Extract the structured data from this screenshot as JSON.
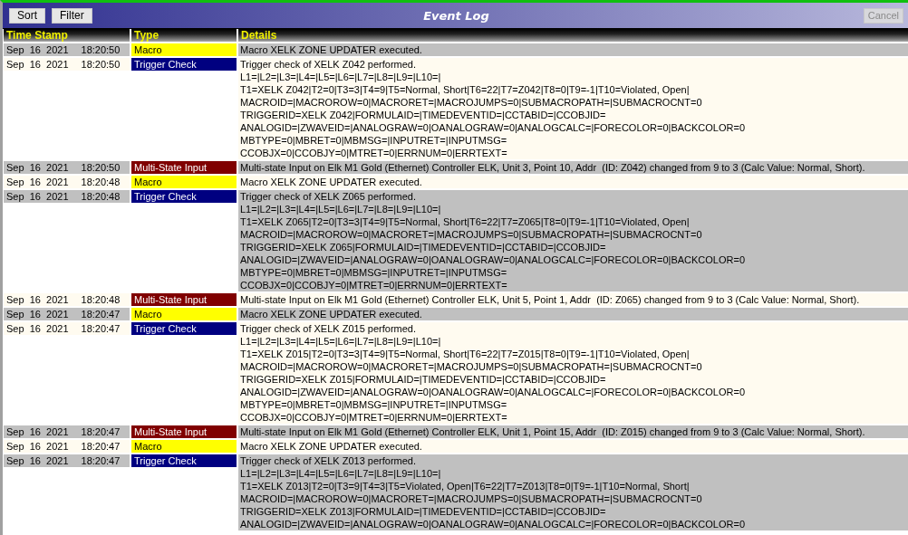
{
  "window": {
    "title": "Event Log"
  },
  "toolbar": {
    "buttons": [
      {
        "label": "Sort",
        "disabled": false
      },
      {
        "label": "Filter",
        "disabled": false
      }
    ],
    "cancel": {
      "label": "Cancel",
      "disabled": true
    }
  },
  "table": {
    "columns": [
      "Time Stamp",
      "Type",
      "Details"
    ],
    "rows": [
      {
        "date": "Sep  16  2021",
        "time": "18:20:50",
        "type": {
          "label": "Macro",
          "kind": "macro"
        },
        "details": [
          "Macro XELK ZONE UPDATER executed."
        ]
      },
      {
        "date": "Sep  16  2021",
        "time": "18:20:50",
        "type": {
          "label": "Trigger Check",
          "kind": "trigger"
        },
        "details": [
          "Trigger check of XELK Z042 performed.",
          "L1=|L2=|L3=|L4=|L5=|L6=|L7=|L8=|L9=|L10=|",
          "T1=XELK Z042|T2=0|T3=3|T4=9|T5=Normal, Short|T6=22|T7=Z042|T8=0|T9=-1|T10=Violated, Open|",
          "MACROID=|MACROROW=0|MACRORET=|MACROJUMPS=0|SUBMACROPATH=|SUBMACROCNT=0",
          "TRIGGERID=XELK Z042|FORMULAID=|TIMEDEVENTID=|CCTABID=|CCOBJID=",
          "ANALOGID=|ZWAVEID=|ANALOGRAW=0|OANALOGRAW=0|ANALOGCALC=|FORECOLOR=0|BACKCOLOR=0",
          "MBTYPE=0|MBRET=0|MBMSG=|INPUTRET=|INPUTMSG=",
          "CCOBJX=0|CCOBJY=0|MTRET=0|ERRNUM=0|ERRTEXT="
        ]
      },
      {
        "date": "Sep  16  2021",
        "time": "18:20:50",
        "type": {
          "label": "Multi-State Input",
          "kind": "multistate"
        },
        "details": [
          "Multi-state Input on Elk M1 Gold (Ethernet) Controller ELK, Unit 3, Point 10, Addr  (ID: Z042) changed from 9 to 3 (Calc Value: Normal, Short)."
        ]
      },
      {
        "date": "Sep  16  2021",
        "time": "18:20:48",
        "type": {
          "label": "Macro",
          "kind": "macro"
        },
        "details": [
          "Macro XELK ZONE UPDATER executed."
        ]
      },
      {
        "date": "Sep  16  2021",
        "time": "18:20:48",
        "type": {
          "label": "Trigger Check",
          "kind": "trigger"
        },
        "details": [
          "Trigger check of XELK Z065 performed.",
          "L1=|L2=|L3=|L4=|L5=|L6=|L7=|L8=|L9=|L10=|",
          "T1=XELK Z065|T2=0|T3=3|T4=9|T5=Normal, Short|T6=22|T7=Z065|T8=0|T9=-1|T10=Violated, Open|",
          "MACROID=|MACROROW=0|MACRORET=|MACROJUMPS=0|SUBMACROPATH=|SUBMACROCNT=0",
          "TRIGGERID=XELK Z065|FORMULAID=|TIMEDEVENTID=|CCTABID=|CCOBJID=",
          "ANALOGID=|ZWAVEID=|ANALOGRAW=0|OANALOGRAW=0|ANALOGCALC=|FORECOLOR=0|BACKCOLOR=0",
          "MBTYPE=0|MBRET=0|MBMSG=|INPUTRET=|INPUTMSG=",
          "CCOBJX=0|CCOBJY=0|MTRET=0|ERRNUM=0|ERRTEXT="
        ]
      },
      {
        "date": "Sep  16  2021",
        "time": "18:20:48",
        "type": {
          "label": "Multi-State Input",
          "kind": "multistate"
        },
        "details": [
          "Multi-state Input on Elk M1 Gold (Ethernet) Controller ELK, Unit 5, Point 1, Addr  (ID: Z065) changed from 9 to 3 (Calc Value: Normal, Short)."
        ]
      },
      {
        "date": "Sep  16  2021",
        "time": "18:20:47",
        "type": {
          "label": "Macro",
          "kind": "macro"
        },
        "details": [
          "Macro XELK ZONE UPDATER executed."
        ]
      },
      {
        "date": "Sep  16  2021",
        "time": "18:20:47",
        "type": {
          "label": "Trigger Check",
          "kind": "trigger"
        },
        "details": [
          "Trigger check of XELK Z015 performed.",
          "L1=|L2=|L3=|L4=|L5=|L6=|L7=|L8=|L9=|L10=|",
          "T1=XELK Z015|T2=0|T3=3|T4=9|T5=Normal, Short|T6=22|T7=Z015|T8=0|T9=-1|T10=Violated, Open|",
          "MACROID=|MACROROW=0|MACRORET=|MACROJUMPS=0|SUBMACROPATH=|SUBMACROCNT=0",
          "TRIGGERID=XELK Z015|FORMULAID=|TIMEDEVENTID=|CCTABID=|CCOBJID=",
          "ANALOGID=|ZWAVEID=|ANALOGRAW=0|OANALOGRAW=0|ANALOGCALC=|FORECOLOR=0|BACKCOLOR=0",
          "MBTYPE=0|MBRET=0|MBMSG=|INPUTRET=|INPUTMSG=",
          "CCOBJX=0|CCOBJY=0|MTRET=0|ERRNUM=0|ERRTEXT="
        ]
      },
      {
        "date": "Sep  16  2021",
        "time": "18:20:47",
        "type": {
          "label": "Multi-State Input",
          "kind": "multistate"
        },
        "details": [
          "Multi-state Input on Elk M1 Gold (Ethernet) Controller ELK, Unit 1, Point 15, Addr  (ID: Z015) changed from 9 to 3 (Calc Value: Normal, Short)."
        ]
      },
      {
        "date": "Sep  16  2021",
        "time": "18:20:47",
        "type": {
          "label": "Macro",
          "kind": "macro"
        },
        "details": [
          "Macro XELK ZONE UPDATER executed."
        ]
      },
      {
        "date": "Sep  16  2021",
        "time": "18:20:47",
        "type": {
          "label": "Trigger Check",
          "kind": "trigger"
        },
        "details": [
          "Trigger check of XELK Z013 performed.",
          "L1=|L2=|L3=|L4=|L5=|L6=|L7=|L8=|L9=|L10=|",
          "T1=XELK Z013|T2=0|T3=9|T4=3|T5=Violated, Open|T6=22|T7=Z013|T8=0|T9=-1|T10=Normal, Short|",
          "MACROID=|MACROROW=0|MACRORET=|MACROJUMPS=0|SUBMACROPATH=|SUBMACROCNT=0",
          "TRIGGERID=XELK Z013|FORMULAID=|TIMEDEVENTID=|CCTABID=|CCOBJID=",
          "ANALOGID=|ZWAVEID=|ANALOGRAW=0|OANALOGRAW=0|ANALOGCALC=|FORECOLOR=0|BACKCOLOR=0"
        ]
      }
    ]
  }
}
